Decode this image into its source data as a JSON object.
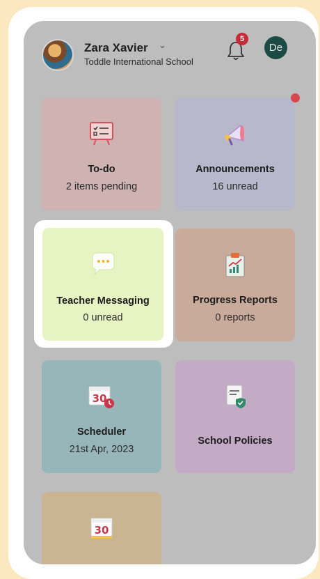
{
  "header": {
    "user_name": "Zara Xavier",
    "chevron": "⌄",
    "school_name": "Toddle International School",
    "notification_count": "5",
    "profile_initials": "De"
  },
  "tiles": {
    "todo": {
      "title": "To-do",
      "subtitle": "2 items pending",
      "icon": "whiteboard-checklist-icon",
      "color": "#cfb2b2"
    },
    "announcements": {
      "title": "Announcements",
      "subtitle": "16 unread",
      "icon": "megaphone-icon",
      "color": "#b8b8cc",
      "has_dot": true
    },
    "teacher_messaging": {
      "title": "Teacher Messaging",
      "subtitle": "0 unread",
      "icon": "chat-bubble-icon",
      "color": "#e6f4c4"
    },
    "progress_reports": {
      "title": "Progress Reports",
      "subtitle": "0 reports",
      "icon": "clipboard-chart-icon",
      "color": "#c9ab9b"
    },
    "scheduler": {
      "title": "Scheduler",
      "subtitle": "21st Apr, 2023",
      "icon": "calendar-clock-icon",
      "icon_text": "30",
      "color": "#97b6b9"
    },
    "school_policies": {
      "title": "School Policies",
      "icon": "document-shield-icon",
      "color": "#c4abc5"
    },
    "partial_tile": {
      "icon": "calendar-icon",
      "icon_text": "30",
      "color": "#c9b592"
    }
  }
}
